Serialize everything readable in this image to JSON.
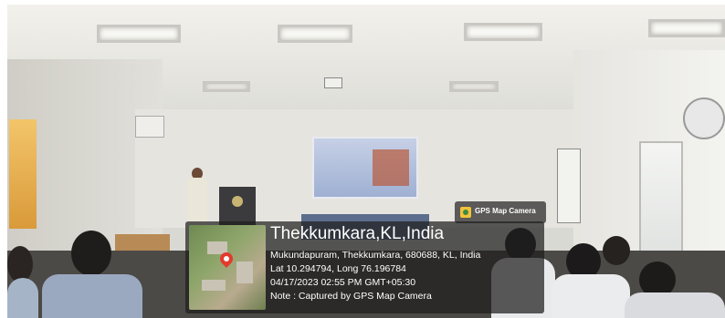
{
  "scene": {
    "setting": "seminar-hall-presentation"
  },
  "gps_badge": {
    "icon": "gps-map-camera-icon",
    "label": "GPS Map Camera"
  },
  "location_stamp": {
    "title": "Thekkumkara,KL,India",
    "address": "Mukundapuram, Thekkumkara, 680688, KL, India",
    "coordinates": "Lat 10.294794, Long 76.196784",
    "datetime": "04/17/2023 02:55 PM GMT+05:30",
    "note": "Note : Captured by GPS Map Camera",
    "map_icon": "location-pin-icon",
    "pin_color": "#e23b2e"
  }
}
